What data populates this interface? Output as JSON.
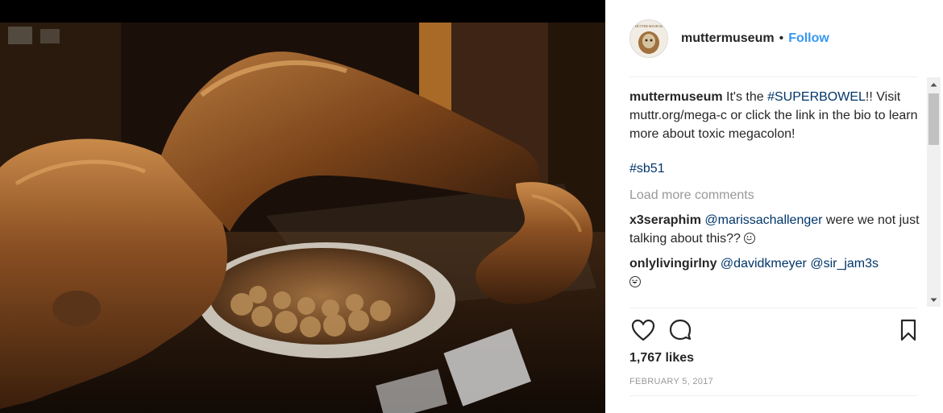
{
  "post": {
    "username": "muttermuseum",
    "separator": "•",
    "follow_label": "Follow",
    "avatar_text": "MÜTTER MUSEUM",
    "caption": {
      "username": "muttermuseum",
      "text_before": " It's the ",
      "hashtag_1": "#SUPERBOWEL",
      "text_after": "!! Visit muttr.org/mega-c or click the link in the bio to learn more about toxic megacolon!",
      "hashtag_2": "#sb51"
    },
    "load_more_label": "Load more comments",
    "comments": [
      {
        "username": "x3seraphim",
        "mention": "@marissachallenger",
        "text": " were we not just talking about this?? ",
        "emoji": "grinning-face"
      },
      {
        "username": "onlylivingirlny",
        "mention": "@davidkmeyer",
        "mention_2": "@sir_jam3s",
        "emoji": "laughing-face"
      }
    ],
    "likes": "1,767 likes",
    "date": "FEBRUARY 5, 2017"
  },
  "icons": {
    "like": "heart-icon",
    "comment": "comment-bubble-icon",
    "save": "bookmark-icon",
    "scroll_up": "scroll-up-arrow-icon",
    "scroll_down": "scroll-down-arrow-icon"
  },
  "colors": {
    "link_blue": "#3897f0",
    "hashtag": "#003569",
    "muted": "#999999",
    "text": "#262626"
  }
}
